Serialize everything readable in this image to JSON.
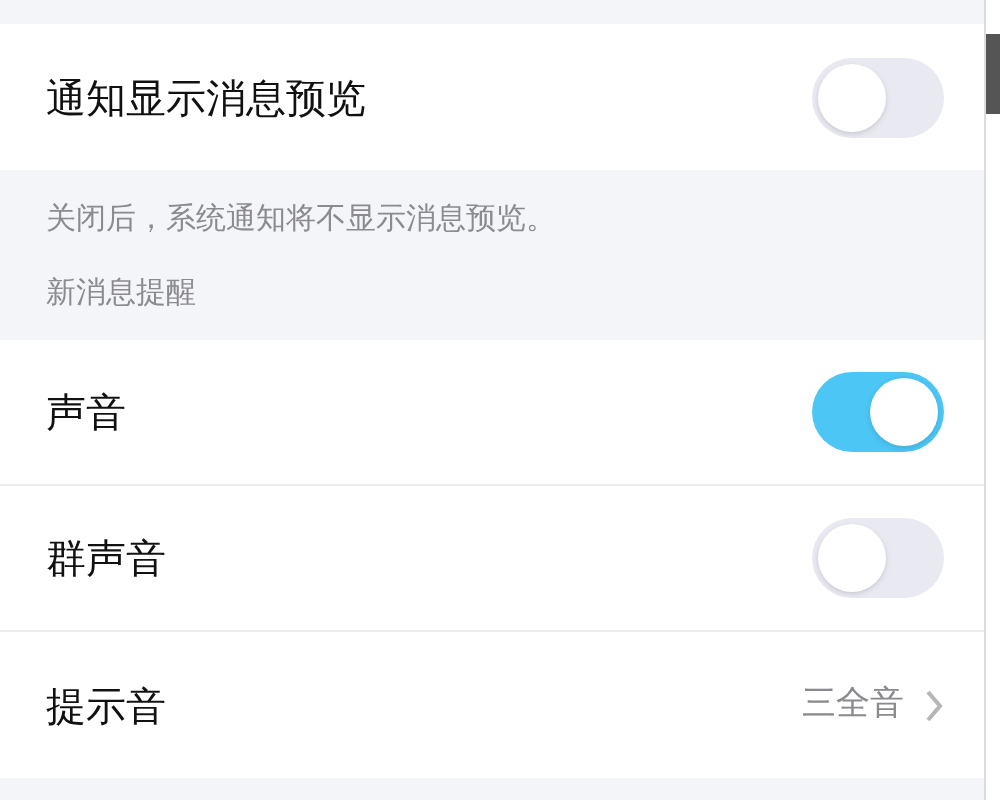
{
  "preview_row": {
    "label": "通知显示消息预览",
    "on": false
  },
  "preview_note": "关闭后，系统通知将不显示消息预览。",
  "section_header": "新消息提醒",
  "rows": [
    {
      "kind": "switch",
      "label": "声音",
      "on": true
    },
    {
      "kind": "switch",
      "label": "群声音",
      "on": false
    },
    {
      "kind": "link",
      "label": "提示音",
      "value": "三全音"
    }
  ]
}
